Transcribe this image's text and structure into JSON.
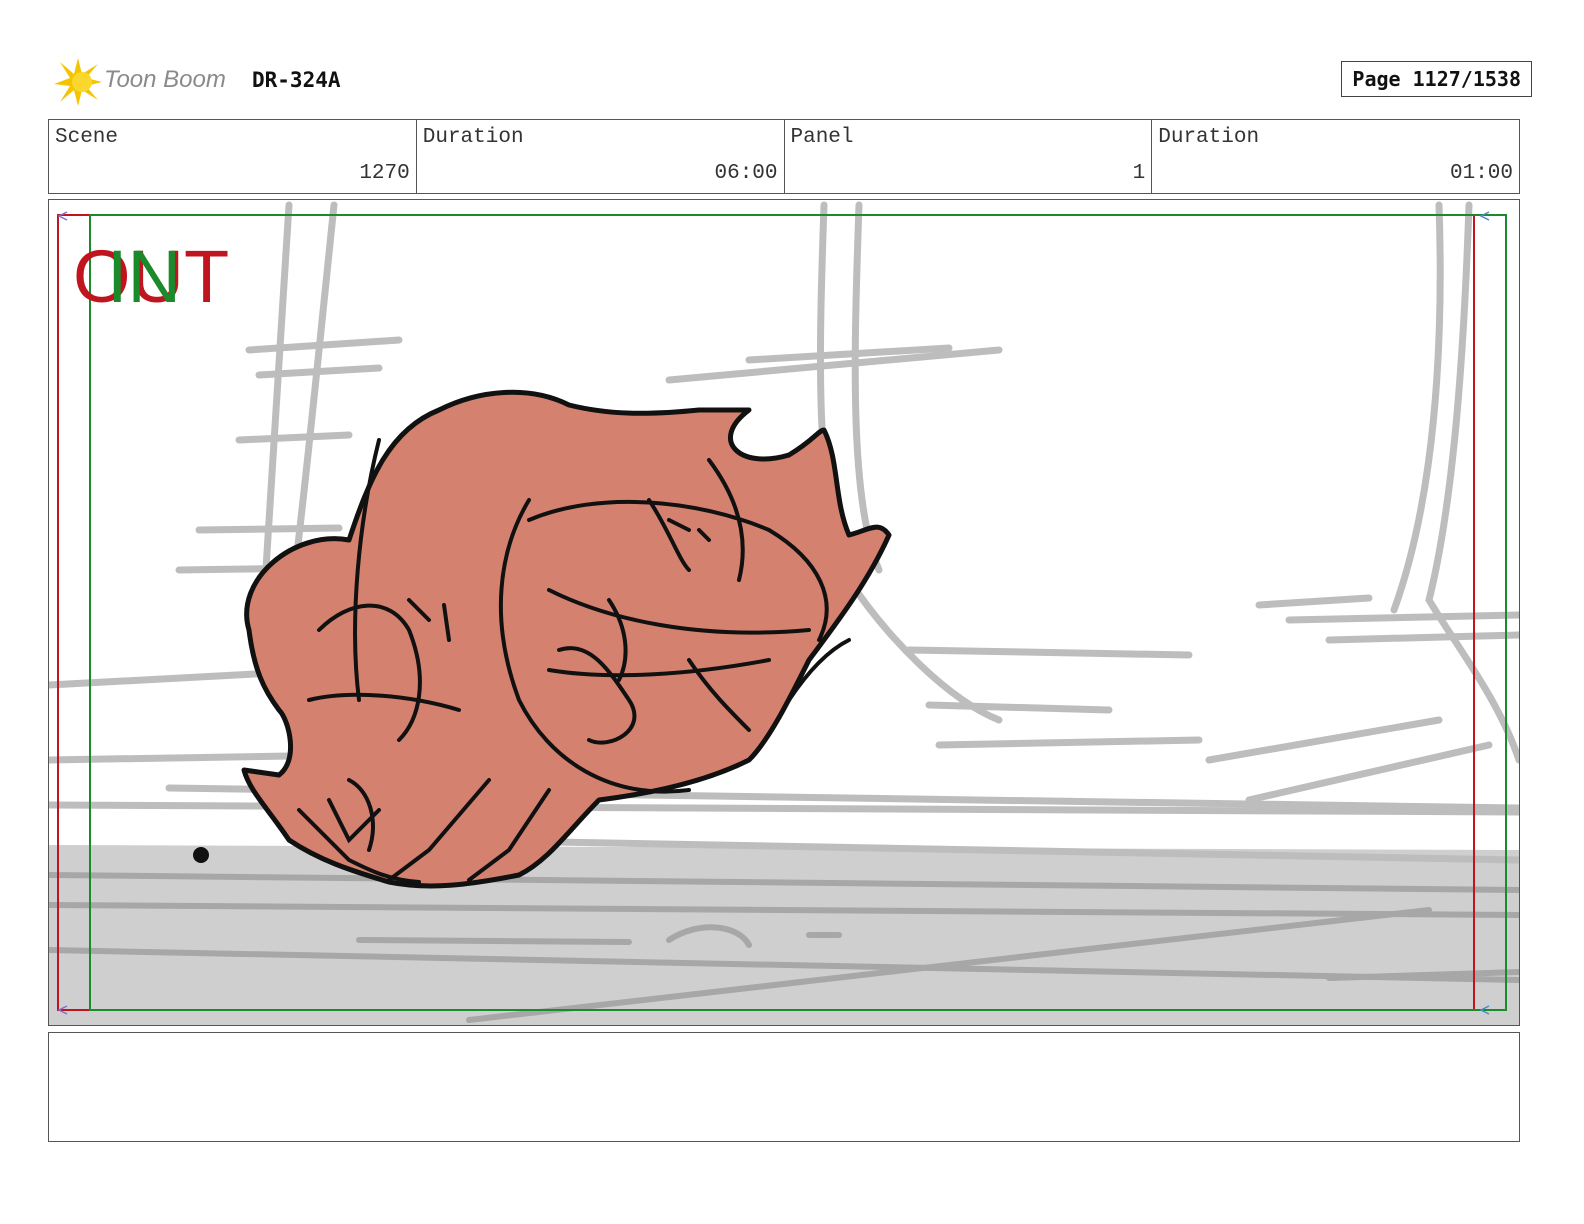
{
  "header": {
    "logo_text": "Toon Boom",
    "doc_code": "DR-324A",
    "page_label": "Page 1127/1538"
  },
  "info": {
    "scene_label": "Scene",
    "scene_value": "1270",
    "scene_duration_label": "Duration",
    "scene_duration_value": "06:00",
    "panel_label": "Panel",
    "panel_value": "1",
    "panel_duration_label": "Duration",
    "panel_duration_value": "01:00"
  },
  "panel": {
    "out_label": "OUT",
    "in_label": "IN",
    "colors": {
      "out_frame": "#c0141e",
      "in_frame": "#1a8a2a",
      "character_fill": "#d4826f",
      "sketch_line": "#bdbdbd",
      "floor": "#cfcfcf"
    }
  },
  "notes": {
    "text": ""
  }
}
